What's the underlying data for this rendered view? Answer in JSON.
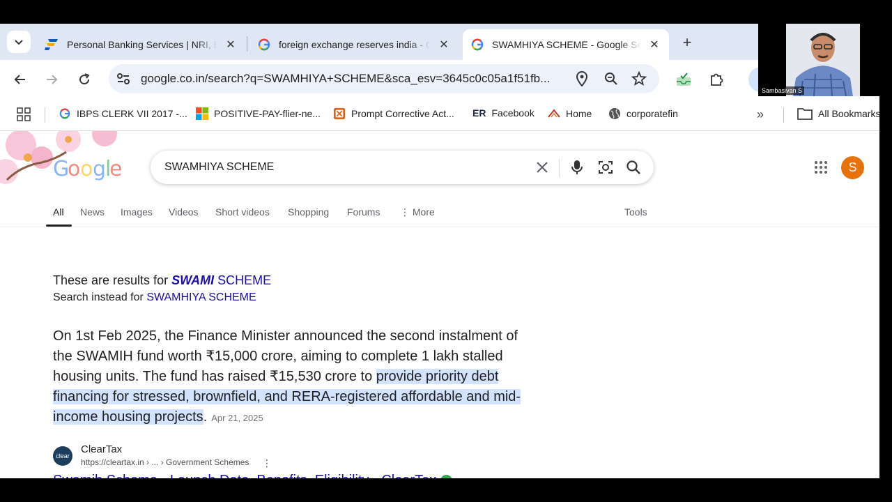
{
  "tabs": [
    {
      "title": "Personal Banking Services | NRI, Bu",
      "icon": "federal-bank-logo"
    },
    {
      "title": "foreign exchange reserves india - G",
      "icon": "google-g-logo"
    },
    {
      "title": "SWAMHIYA SCHEME - Google Sea",
      "icon": "google-g-logo",
      "active": true
    }
  ],
  "toolbar": {
    "url": "google.co.in/search?q=SWAMHIYA+SCHEME&sca_esv=3645c0c05a1f51fb..."
  },
  "bookmarks": [
    {
      "label": "IBPS CLERK VII 2017 -...",
      "icon": "google-g-logo"
    },
    {
      "label": "POSITIVE-PAY-flier-ne...",
      "icon": "microsoft-logo"
    },
    {
      "label": "Prompt Corrective Act...",
      "icon": "extension-logo"
    },
    {
      "label": "Facebook",
      "icon": "er-logo",
      "prefix": "ER"
    },
    {
      "label": "Home",
      "icon": "home-logo"
    },
    {
      "label": "corporatefin",
      "icon": "globe-icon"
    }
  ],
  "all_bookmarks": "All Bookmarks",
  "search": {
    "query": "SWAMHIYA SCHEME"
  },
  "avatar_letter": "S",
  "nav": {
    "all": "All",
    "news": "News",
    "images": "Images",
    "videos": "Videos",
    "short_videos": "Short videos",
    "shopping": "Shopping",
    "forums": "Forums",
    "more": "More",
    "tools": "Tools"
  },
  "results": {
    "results_for_prefix": "These are results for",
    "results_for_bold": "SWAMI",
    "results_for_suffix": "SCHEME",
    "search_instead_prefix": "Search instead for",
    "search_instead_link": "SWAMHIYA SCHEME",
    "snippet_plain": "On 1st Feb 2025, the Finance Minister announced the second instalment of the SWAMIH fund worth ₹15,000 crore, aiming to complete 1 lakh stalled housing units. The fund has raised ₹15,530 crore to ",
    "snippet_highlight": "provide priority debt financing for stressed, brownfield, and RERA-registered affordable and mid-income housing projects",
    "snippet_end": ".",
    "snippet_date": "Apr 21, 2025",
    "source_name": "ClearTax",
    "source_url": "https://cleartax.in › ... › Government Schemes",
    "favicon_text": "clear",
    "link_title": "Swamih Scheme - Launch Date, Benefits, Eligibility - ClearTax"
  },
  "webcam": {
    "name": "Sambasivan S"
  }
}
